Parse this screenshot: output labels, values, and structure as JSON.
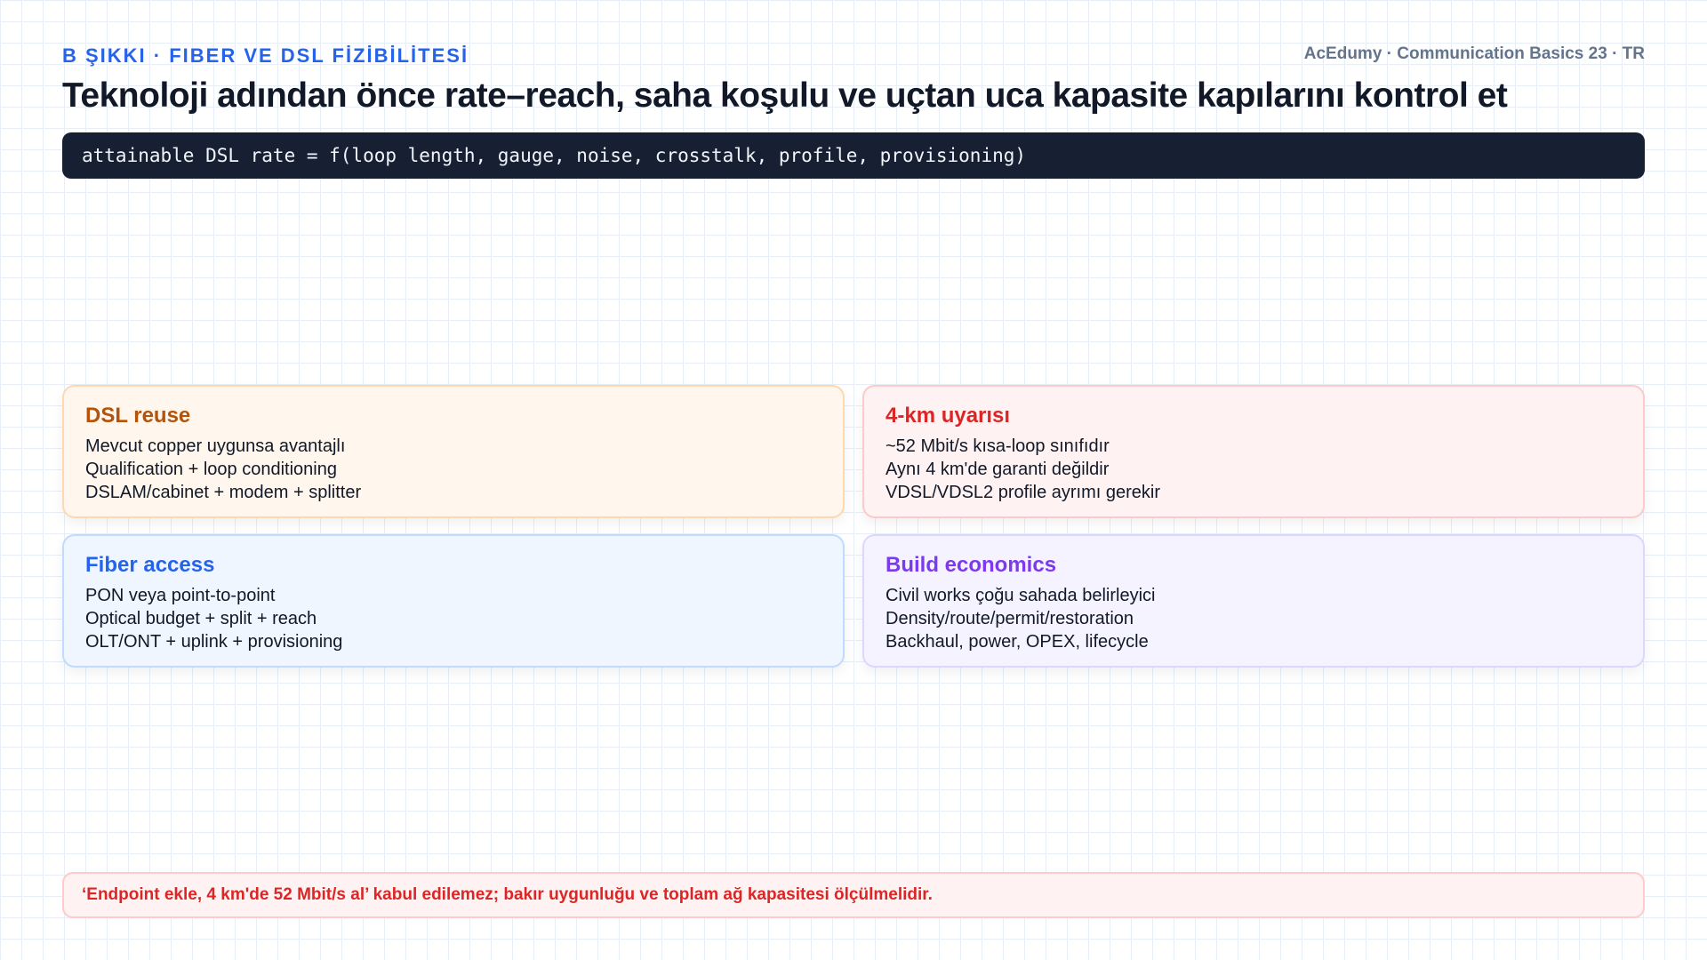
{
  "header": {
    "kicker": "B ŞIKKI · FIBER VE DSL FİZİBİLİTESİ",
    "brand": "AcEdumy · Communication Basics 23 · TR",
    "title": "Teknoloji adından önce rate–reach, saha koşulu ve uçtan uca kapasite kapılarını kontrol et"
  },
  "formula": "attainable DSL rate = f(loop length, gauge, noise, crosstalk, profile, provisioning)",
  "cards": [
    {
      "name": "dsl-reuse",
      "title": "DSL reuse",
      "title_color": "#b45309",
      "bg_color": "#fff7ed",
      "border_color": "#fcd9b0",
      "lines": [
        "Mevcut copper uygunsa avantajlı",
        "Qualification + loop conditioning",
        "DSLAM/cabinet + modem + splitter"
      ]
    },
    {
      "name": "4km-warning",
      "title": "4-km uyarısı",
      "title_color": "#dc2626",
      "bg_color": "#fef2f2",
      "border_color": "#fbcaca",
      "lines": [
        "~52 Mbit/s kısa-loop sınıfıdır",
        "Aynı 4 km'de garanti değildir",
        "VDSL/VDSL2 profile ayrımı gerekir"
      ]
    },
    {
      "name": "fiber-access",
      "title": "Fiber access",
      "title_color": "#2563eb",
      "bg_color": "#eff6ff",
      "border_color": "#bfdbfe",
      "lines": [
        "PON veya point-to-point",
        "Optical budget + split + reach",
        "OLT/ONT + uplink + provisioning"
      ]
    },
    {
      "name": "build-economics",
      "title": "Build economics",
      "title_color": "#7c3aed",
      "bg_color": "#f5f3ff",
      "border_color": "#ddd6fe",
      "lines": [
        "Civil works çoğu sahada belirleyici",
        "Density/route/permit/restoration",
        "Backhaul, power, OPEX, lifecycle"
      ]
    }
  ],
  "note": "‘Endpoint ekle, 4 km'de 52 Mbit/s al’ kabul edilemez; bakır uygunluğu ve toplam ağ kapasitesi ölçülmelidir."
}
